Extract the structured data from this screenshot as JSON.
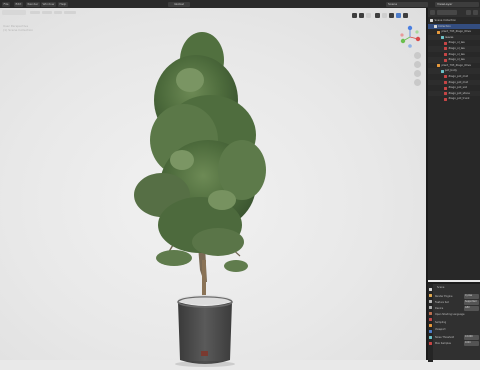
{
  "topbar": {
    "menus": [
      "File",
      "Edit",
      "Render",
      "Window",
      "Help"
    ],
    "view_title": "Global",
    "scene": "Scene",
    "view_layer": "ViewLayer"
  },
  "viewport": {
    "overlay_lines": [
      "User Perspective",
      "(1) Scene Collection",
      ""
    ]
  },
  "outliner": {
    "rows": [
      {
        "label": "Scene Collection",
        "indent": 0,
        "icon": "collection-icon",
        "selected": false
      },
      {
        "label": "Collection",
        "indent": 1,
        "icon": "collection-icon",
        "selected": true
      },
      {
        "label": "plant_793_Ziago_Olive",
        "indent": 2,
        "icon": "object-icon",
        "selected": false
      },
      {
        "label": "leaves",
        "indent": 3,
        "icon": "mesh-icon",
        "selected": false
      },
      {
        "label": "Ziago_ol_lea",
        "indent": 4,
        "icon": "material-icon",
        "selected": false
      },
      {
        "label": "Ziago_ol_lea",
        "indent": 4,
        "icon": "material-icon",
        "selected": false
      },
      {
        "label": "Ziago_ol_lea",
        "indent": 4,
        "icon": "material-icon",
        "selected": false
      },
      {
        "label": "Ziago_ol_lea",
        "indent": 4,
        "icon": "material-icon",
        "selected": false
      },
      {
        "label": "plant_793_Ziago_Olive",
        "indent": 2,
        "icon": "object-icon",
        "selected": false
      },
      {
        "label": "pot_body",
        "indent": 3,
        "icon": "mesh-icon",
        "selected": false
      },
      {
        "label": "Ziago_pot_mat",
        "indent": 4,
        "icon": "material-icon",
        "selected": false
      },
      {
        "label": "Ziago_pot_mat",
        "indent": 4,
        "icon": "material-icon",
        "selected": false
      },
      {
        "label": "Ziago_pot_soil",
        "indent": 4,
        "icon": "material-icon",
        "selected": false
      },
      {
        "label": "Ziago_pot_stone",
        "indent": 4,
        "icon": "material-icon",
        "selected": false
      },
      {
        "label": "Ziago_pot_trunk",
        "indent": 4,
        "icon": "material-icon",
        "selected": false
      }
    ]
  },
  "properties": {
    "header": "Scene",
    "rows": [
      {
        "label": "Render Engine",
        "value": "Cycles"
      },
      {
        "label": "Feature Set",
        "value": "Supported"
      },
      {
        "label": "Device",
        "value": "GPU"
      },
      {
        "label": "Open Shading Language",
        "value": ""
      },
      {
        "label": "Sampling",
        "value": ""
      },
      {
        "label": "Viewport",
        "value": ""
      },
      {
        "label": "Noise Threshold",
        "value": "0.1000"
      },
      {
        "label": "Max Samples",
        "value": "1024"
      }
    ]
  },
  "colors": {
    "selection": "#334d80",
    "accent_blue": "#4d7cc9",
    "material_red": "#c74545",
    "object_orange": "#e79a3c",
    "collection_white": "#d6d6d6",
    "mesh_teal": "#6ec3c9"
  }
}
